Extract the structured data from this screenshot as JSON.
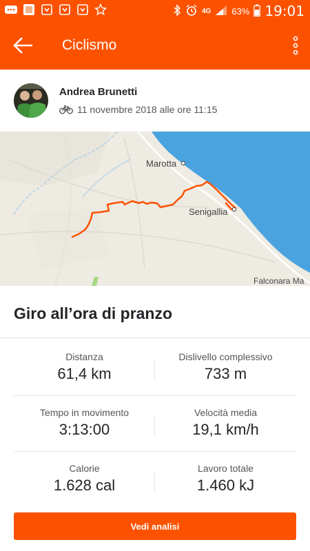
{
  "status_bar": {
    "battery": "63%",
    "network": "4G",
    "time": "19:01"
  },
  "app_bar": {
    "title": "Ciclismo"
  },
  "activity": {
    "user_name": "Andrea Brunetti",
    "date_text": "11 novembre 2018 alle ore 11:15",
    "title": "Giro all’ora di pranzo"
  },
  "map": {
    "places": [
      "Marotta",
      "Senigallia",
      "Falconara Ma"
    ]
  },
  "stats": [
    {
      "label": "Distanza",
      "value": "61,4 km"
    },
    {
      "label": "Dislivello complessivo",
      "value": "733 m"
    },
    {
      "label": "Tempo in movimento",
      "value": "3:13:00"
    },
    {
      "label": "Velocità media",
      "value": "19,1 km/h"
    },
    {
      "label": "Calorie",
      "value": "1.628 cal"
    },
    {
      "label": "Lavoro totale",
      "value": "1.460 kJ"
    }
  ],
  "cta_label": "Vedi analisi",
  "colors": {
    "brand": "#fc5200",
    "sea": "#4aa3df",
    "route": "#fc5200"
  }
}
